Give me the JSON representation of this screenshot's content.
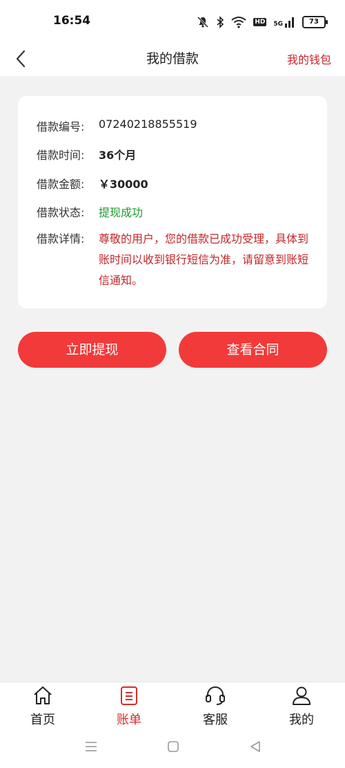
{
  "status_bar": {
    "time": "16:54",
    "battery": "73",
    "network": "5G",
    "hd": "HD"
  },
  "header": {
    "title": "我的借款",
    "wallet_link": "我的钱包"
  },
  "loan": {
    "fields": [
      {
        "label": "借款编号:",
        "value": "07240218855519"
      },
      {
        "label": "借款时间:",
        "value": "36个月"
      },
      {
        "label": "借款金额:",
        "value": "￥30000"
      },
      {
        "label": "借款状态:",
        "value": "提现成功"
      },
      {
        "label": "借款详情:",
        "value": "尊敬的用户，您的借款已成功受理，具体到账时间以收到银行短信为准，请留意到账短信通知。"
      }
    ]
  },
  "actions": {
    "withdraw": "立即提现",
    "contract": "查看合同"
  },
  "tabs": [
    {
      "label": "首页",
      "icon": "home-icon"
    },
    {
      "label": "账单",
      "icon": "bill-icon",
      "active": true
    },
    {
      "label": "客服",
      "icon": "headset-icon"
    },
    {
      "label": "我的",
      "icon": "user-icon"
    }
  ],
  "colors": {
    "accent": "#f23a3a",
    "link": "#c8232c",
    "success": "#1e9a2e"
  }
}
